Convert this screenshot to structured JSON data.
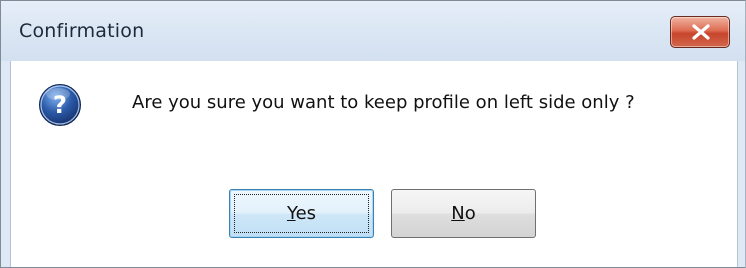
{
  "dialog": {
    "title": "Confirmation",
    "message": "Are you sure you want to keep profile on left side only ?",
    "icon": "question-icon",
    "close_icon": "close-icon"
  },
  "buttons": {
    "yes": {
      "mnemonic": "Y",
      "rest": "es"
    },
    "no": {
      "mnemonic": "N",
      "rest": "o"
    }
  },
  "colors": {
    "close_button": "#c7452c",
    "question_icon": "#2a5aa8",
    "default_button_border": "#3c7fb1"
  }
}
